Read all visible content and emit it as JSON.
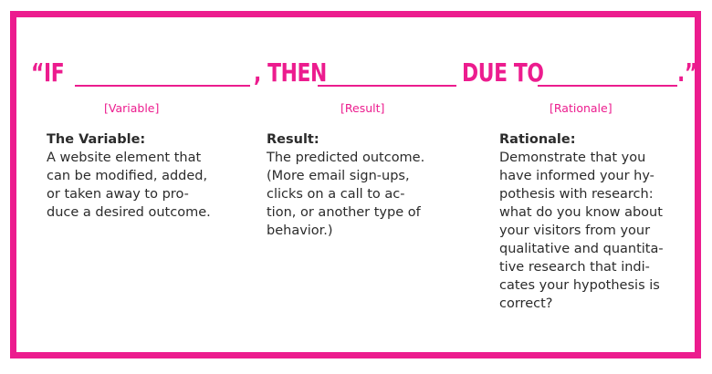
{
  "headline": {
    "part1": "“IF",
    "part2": ", THEN",
    "part3": "DUE TO",
    "part4": ".”"
  },
  "labels": {
    "variable": "[Variable]",
    "result": "[Result]",
    "rationale": "[Rationale]"
  },
  "columns": {
    "variable": {
      "title": "The Variable:",
      "lines": [
        "A website element that",
        "can be modified, added,",
        "or taken away to pro-",
        "duce a desired outcome."
      ]
    },
    "result": {
      "title": "Result:",
      "lines": [
        "The predicted outcome.",
        "(More email sign-ups,",
        "clicks on a call to ac-",
        "tion, or another type of",
        "behavior.)"
      ]
    },
    "rationale": {
      "title": "Rationale:",
      "lines": [
        "Demonstrate that you",
        "have informed your hy-",
        "pothesis with research:",
        "what do you know about",
        "your visitors from your",
        "qualitative and quantita-",
        "tive research that indi-",
        "cates your hypothesis is",
        "correct?"
      ]
    }
  },
  "colors": {
    "accent": "#ec1c8e",
    "text": "#2b2b2b",
    "background": "#ffffff"
  }
}
